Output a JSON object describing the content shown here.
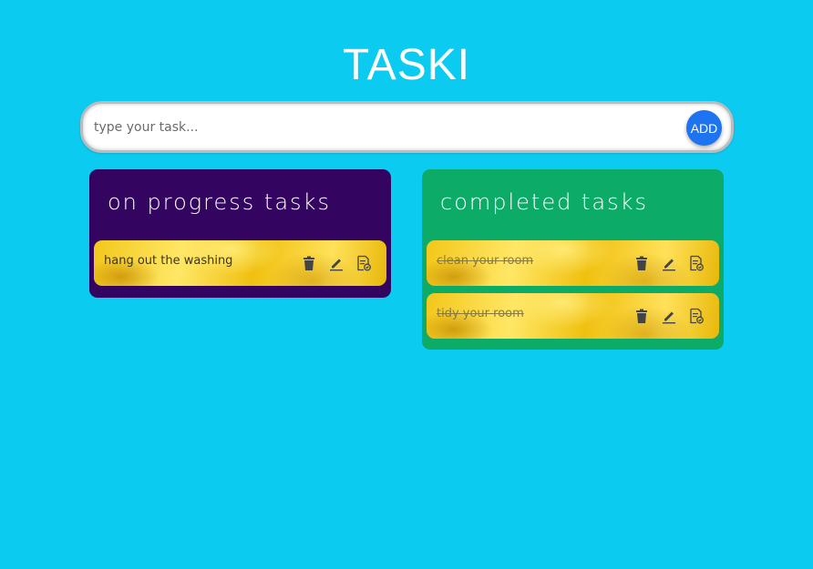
{
  "app": {
    "title": "TASKI"
  },
  "input": {
    "placeholder": "type your task...",
    "add_label": "ADD"
  },
  "progress": {
    "title": "on progress tasks",
    "tasks": [
      {
        "text": "hang out the washing"
      }
    ]
  },
  "completed": {
    "title": "completed tasks",
    "tasks": [
      {
        "text": "clean your room"
      },
      {
        "text": "tidy your room"
      }
    ]
  },
  "icons": {
    "delete": "trash-icon",
    "edit": "pencil-icon",
    "complete": "document-check-icon"
  },
  "colors": {
    "background": "#0ccbf0",
    "progress_panel": "#330561",
    "completed_panel": "#0cab68",
    "add_button": "#1e73f0"
  }
}
